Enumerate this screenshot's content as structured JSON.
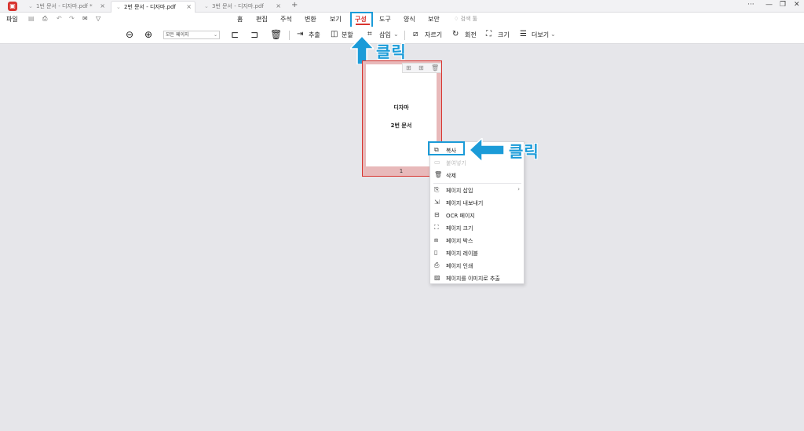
{
  "tabs": [
    {
      "label": "1번 문서 - 디자마.pdf *",
      "close": "×"
    },
    {
      "label": "2번 문서 - 디자마.pdf",
      "close": "×"
    },
    {
      "label": "3번 문서 - 디자마.pdf",
      "close": "×"
    }
  ],
  "tab_plus": "+",
  "window_controls": {
    "more": "···",
    "minimize": "—",
    "restore": "❐",
    "close": "✕"
  },
  "file_menu": "파일",
  "menu": [
    "홈",
    "편집",
    "주석",
    "변환",
    "보기",
    "구성",
    "도구",
    "양식",
    "보안"
  ],
  "active_menu": "구성",
  "search_menu": "검색 툴",
  "toolbar": {
    "page_select": "모든 페이지",
    "extract": "추출",
    "split": "분할",
    "insert": "삽입",
    "crop": "자르기",
    "rotate": "회전",
    "size": "크기",
    "more": "더보기"
  },
  "annotation": {
    "click_1": "클릭",
    "click_2": "클릭"
  },
  "thumbnail": {
    "title": "디자마",
    "subtitle": "2번 문서",
    "page_number": "1"
  },
  "context_menu": [
    {
      "label": "복사",
      "icon": "copy-icon",
      "disabled": false
    },
    {
      "label": "붙여넣기",
      "icon": "paste-icon",
      "disabled": true
    },
    {
      "label": "삭제",
      "icon": "trash-icon",
      "disabled": false
    },
    {
      "label": "페이지 삽입",
      "icon": "insert-page-icon",
      "disabled": false,
      "submenu": true
    },
    {
      "label": "페이지 내보내기",
      "icon": "export-page-icon",
      "disabled": false
    },
    {
      "label": "OCR 페이지",
      "icon": "ocr-icon",
      "disabled": false
    },
    {
      "label": "페이지 크기",
      "icon": "page-size-icon",
      "disabled": false
    },
    {
      "label": "페이지 박스",
      "icon": "page-box-icon",
      "disabled": false
    },
    {
      "label": "페이지 레이블",
      "icon": "page-label-icon",
      "disabled": false
    },
    {
      "label": "페이지 인쇄",
      "icon": "print-icon",
      "disabled": false
    },
    {
      "label": "페이지를 이미지로 추출",
      "icon": "image-extract-icon",
      "disabled": false
    }
  ],
  "colors": {
    "accent": "#d8342f",
    "highlight": "#1b9bd8"
  }
}
